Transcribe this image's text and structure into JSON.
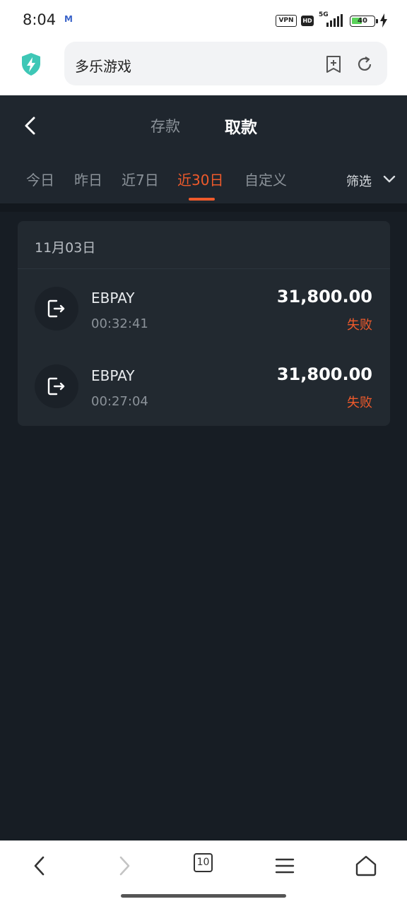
{
  "status_bar": {
    "time": "8:04",
    "notif_letter": "M",
    "vpn": "VPN",
    "hd": "HD",
    "network": "5G",
    "battery": "40"
  },
  "browser": {
    "url_text": "多乐游戏",
    "tabs_count": "10"
  },
  "header": {
    "tabs": [
      "存款",
      "取款"
    ],
    "active_tab": "取款"
  },
  "filters": {
    "items": [
      "今日",
      "昨日",
      "近7日",
      "近30日",
      "自定义"
    ],
    "active": "近30日",
    "screen_label": "筛选"
  },
  "records": {
    "date": "11月03日",
    "rows": [
      {
        "name": "EBPAY",
        "time": "00:32:41",
        "amount": "31,800.00",
        "status": "失败"
      },
      {
        "name": "EBPAY",
        "time": "00:27:04",
        "amount": "31,800.00",
        "status": "失败"
      }
    ]
  },
  "colors": {
    "accent": "#ef5a2b",
    "background": "#171d24",
    "card": "#222930",
    "header": "#1f262e"
  }
}
